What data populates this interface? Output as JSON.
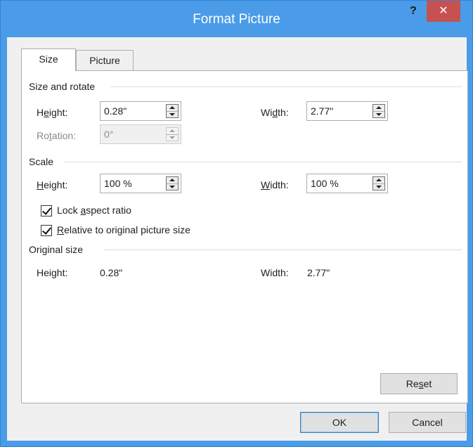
{
  "window": {
    "title": "Format Picture",
    "help_label": "?",
    "close_label": "✕"
  },
  "tabs": [
    {
      "label": "Size",
      "active": true
    },
    {
      "label": "Picture",
      "active": false
    }
  ],
  "size_and_rotate": {
    "title": "Size and rotate",
    "height": {
      "label_pre": "H",
      "label_u": "e",
      "label_post": "ight:",
      "value": "0.28\""
    },
    "width": {
      "label_pre": "Wi",
      "label_u": "d",
      "label_post": "th:",
      "value": "2.77\""
    },
    "rotation": {
      "label_pre": "Ro",
      "label_u": "t",
      "label_post": "ation:",
      "value": "0°",
      "disabled": true
    }
  },
  "scale": {
    "title": "Scale",
    "height": {
      "label_u": "H",
      "label_post": "eight:",
      "value": "100 %"
    },
    "width": {
      "label_u": "W",
      "label_post": "idth:",
      "value": "100 %"
    },
    "lock_aspect": {
      "label_pre": "Lock ",
      "label_u": "a",
      "label_post": "spect ratio",
      "checked": true
    },
    "relative": {
      "label_u": "R",
      "label_post": "elative to original picture size",
      "checked": true
    }
  },
  "original_size": {
    "title": "Original size",
    "height_label": "Height:",
    "height_value": "0.28\"",
    "width_label": "Width:",
    "width_value": "2.77\""
  },
  "buttons": {
    "reset_pre": "Re",
    "reset_u": "s",
    "reset_post": "et",
    "ok": "OK",
    "cancel": "Cancel"
  },
  "colors": {
    "titlebar": "#4a9ce8",
    "close": "#c75050",
    "dialog_bg": "#f0f0f0"
  }
}
